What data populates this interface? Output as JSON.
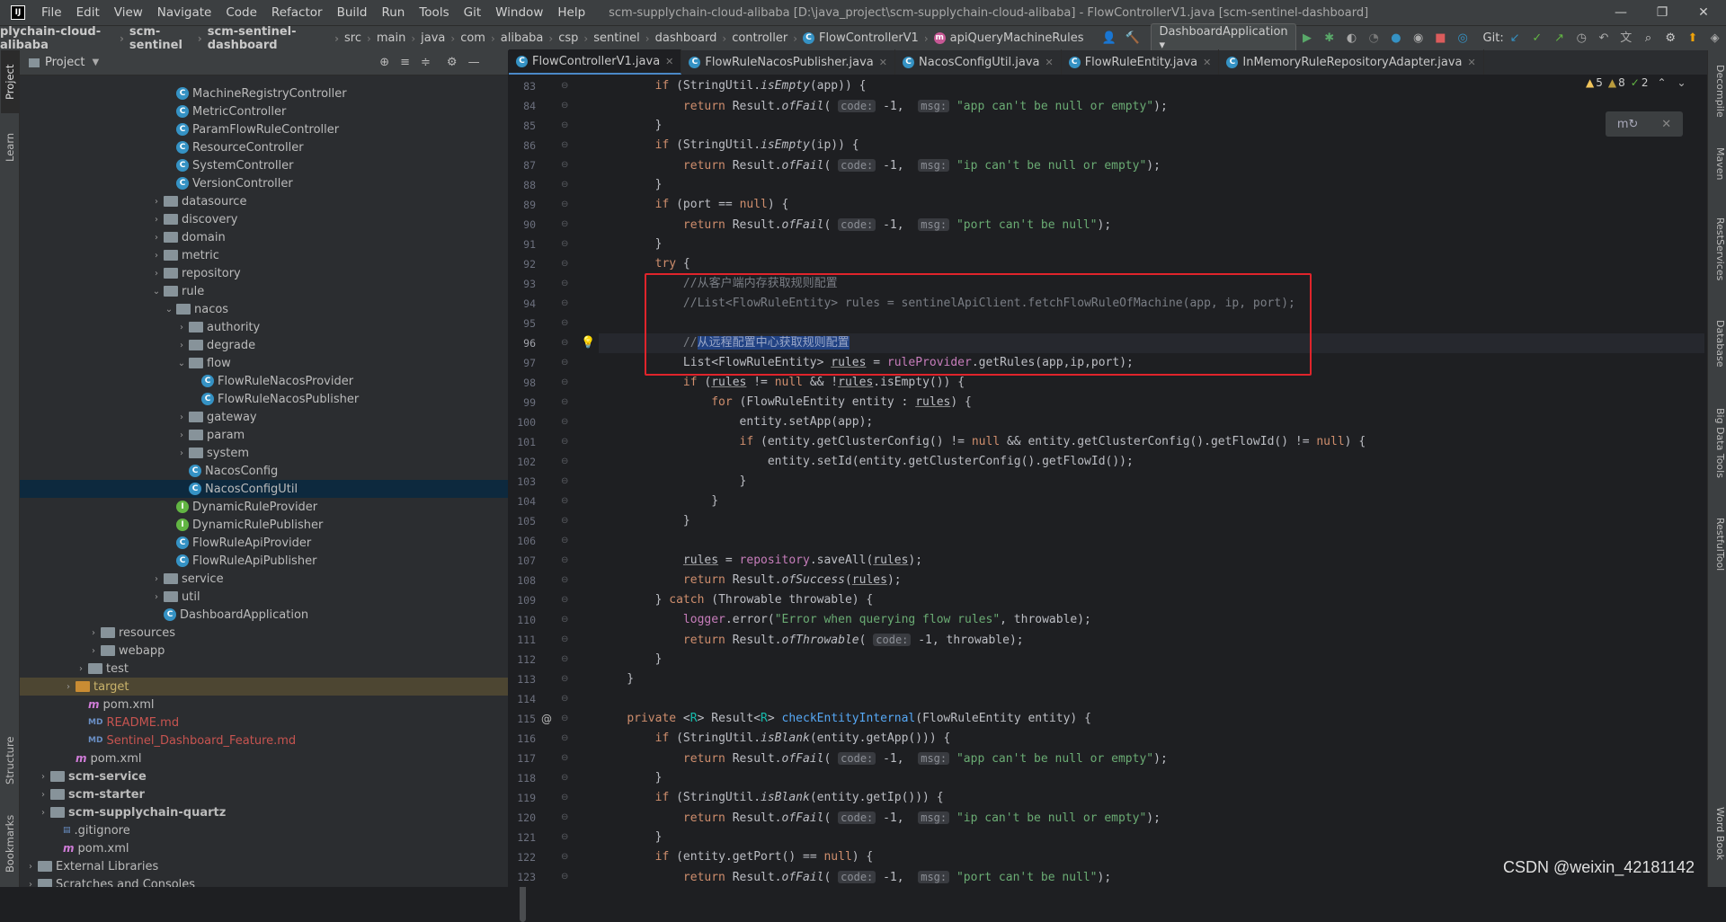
{
  "menubar": {
    "logo": "IJ",
    "items": [
      "File",
      "Edit",
      "View",
      "Navigate",
      "Code",
      "Refactor",
      "Build",
      "Run",
      "Tools",
      "Git",
      "Window",
      "Help"
    ],
    "title": "scm-supplychain-cloud-alibaba [D:\\java_project\\scm-supplychain-cloud-alibaba] - FlowControllerV1.java [scm-sentinel-dashboard]"
  },
  "navbar": {
    "crumbs": [
      "plychain-cloud-alibaba",
      "scm-sentinel",
      "scm-sentinel-dashboard",
      "src",
      "main",
      "java",
      "com",
      "alibaba",
      "csp",
      "sentinel",
      "dashboard",
      "controller",
      "FlowControllerV1",
      "apiQueryMachineRules"
    ],
    "run_config": "DashboardApplication",
    "git_label": "Git:"
  },
  "left_stripe": {
    "project": "Project",
    "learn": "Learn",
    "structure": "Structure",
    "bookmarks": "Bookmarks"
  },
  "project_panel": {
    "title": "Project",
    "tree": [
      {
        "label": "MachineRegistryController",
        "type": "class",
        "indent": 11
      },
      {
        "label": "MetricController",
        "type": "class",
        "indent": 11
      },
      {
        "label": "ParamFlowRuleController",
        "type": "class",
        "indent": 11
      },
      {
        "label": "ResourceController",
        "type": "class",
        "indent": 11
      },
      {
        "label": "SystemController",
        "type": "class",
        "indent": 11
      },
      {
        "label": "VersionController",
        "type": "class",
        "indent": 11
      },
      {
        "label": "datasource",
        "type": "folder",
        "indent": 10,
        "arrow": "›"
      },
      {
        "label": "discovery",
        "type": "folder",
        "indent": 10,
        "arrow": "›"
      },
      {
        "label": "domain",
        "type": "folder",
        "indent": 10,
        "arrow": "›"
      },
      {
        "label": "metric",
        "type": "folder",
        "indent": 10,
        "arrow": "›"
      },
      {
        "label": "repository",
        "type": "folder",
        "indent": 10,
        "arrow": "›"
      },
      {
        "label": "rule",
        "type": "folder",
        "indent": 10,
        "arrow": "⌄"
      },
      {
        "label": "nacos",
        "type": "folder",
        "indent": 11,
        "arrow": "⌄"
      },
      {
        "label": "authority",
        "type": "folder",
        "indent": 12,
        "arrow": "›"
      },
      {
        "label": "degrade",
        "type": "folder",
        "indent": 12,
        "arrow": "›"
      },
      {
        "label": "flow",
        "type": "folder",
        "indent": 12,
        "arrow": "⌄"
      },
      {
        "label": "FlowRuleNacosProvider",
        "type": "class",
        "indent": 13
      },
      {
        "label": "FlowRuleNacosPublisher",
        "type": "class",
        "indent": 13
      },
      {
        "label": "gateway",
        "type": "folder",
        "indent": 12,
        "arrow": "›"
      },
      {
        "label": "param",
        "type": "folder",
        "indent": 12,
        "arrow": "›"
      },
      {
        "label": "system",
        "type": "folder",
        "indent": 12,
        "arrow": "›"
      },
      {
        "label": "NacosConfig",
        "type": "class",
        "indent": 12
      },
      {
        "label": "NacosConfigUtil",
        "type": "class",
        "indent": 12,
        "selected": true
      },
      {
        "label": "DynamicRuleProvider",
        "type": "iface",
        "indent": 11
      },
      {
        "label": "DynamicRulePublisher",
        "type": "iface",
        "indent": 11
      },
      {
        "label": "FlowRuleApiProvider",
        "type": "class",
        "indent": 11
      },
      {
        "label": "FlowRuleApiPublisher",
        "type": "class",
        "indent": 11
      },
      {
        "label": "service",
        "type": "folder",
        "indent": 10,
        "arrow": "›"
      },
      {
        "label": "util",
        "type": "folder",
        "indent": 10,
        "arrow": "›"
      },
      {
        "label": "DashboardApplication",
        "type": "class",
        "indent": 10
      },
      {
        "label": "resources",
        "type": "folder",
        "indent": 5,
        "arrow": "›"
      },
      {
        "label": "webapp",
        "type": "folder",
        "indent": 5,
        "arrow": "›"
      },
      {
        "label": "test",
        "type": "folder",
        "indent": 4,
        "arrow": "›"
      },
      {
        "label": "target",
        "type": "folder-orange",
        "indent": 3,
        "arrow": "›",
        "highlight": true
      },
      {
        "label": "pom.xml",
        "type": "maven",
        "indent": 4
      },
      {
        "label": "README.md",
        "type": "md",
        "indent": 4,
        "red": true
      },
      {
        "label": "Sentinel_Dashboard_Feature.md",
        "type": "md",
        "indent": 4,
        "red": true
      },
      {
        "label": "pom.xml",
        "type": "maven",
        "indent": 3
      },
      {
        "label": "scm-service",
        "type": "folder",
        "indent": 1,
        "arrow": "›",
        "bold": true
      },
      {
        "label": "scm-starter",
        "type": "folder",
        "indent": 1,
        "arrow": "›",
        "bold": true
      },
      {
        "label": "scm-supplychain-quartz",
        "type": "folder",
        "indent": 1,
        "arrow": "›",
        "bold": true
      },
      {
        "label": ".gitignore",
        "type": "file",
        "indent": 2
      },
      {
        "label": "pom.xml",
        "type": "maven",
        "indent": 2
      },
      {
        "label": "External Libraries",
        "type": "lib",
        "indent": 0,
        "arrow": "›"
      },
      {
        "label": "Scratches and Consoles",
        "type": "scratch",
        "indent": 0,
        "arrow": "›"
      }
    ]
  },
  "editor": {
    "tabs": [
      {
        "label": "FlowControllerV1.java",
        "active": true
      },
      {
        "label": "FlowRuleNacosPublisher.java"
      },
      {
        "label": "NacosConfigUtil.java"
      },
      {
        "label": "FlowRuleEntity.java"
      },
      {
        "label": "InMemoryRuleRepositoryAdapter.java"
      }
    ],
    "inspections": {
      "warnings": "5",
      "weak": "8",
      "typos": "2"
    },
    "line_numbers": [
      "83",
      "84",
      "85",
      "86",
      "87",
      "88",
      "89",
      "90",
      "91",
      "92",
      "93",
      "94",
      "95",
      "96",
      "97",
      "98",
      "99",
      "100",
      "101",
      "102",
      "103",
      "104",
      "105",
      "106",
      "107",
      "108",
      "109",
      "110",
      "111",
      "112",
      "113",
      "114",
      "115",
      "116",
      "117",
      "118",
      "119",
      "120",
      "121",
      "122",
      "123"
    ],
    "current_line": "96"
  },
  "right_stripe": {
    "items": [
      "Decompile",
      "Maven",
      "RestServices",
      "Database",
      "Big Data Tools",
      "RestfulTool",
      "Word Book"
    ]
  },
  "watermark": "CSDN @weixin_42181142"
}
